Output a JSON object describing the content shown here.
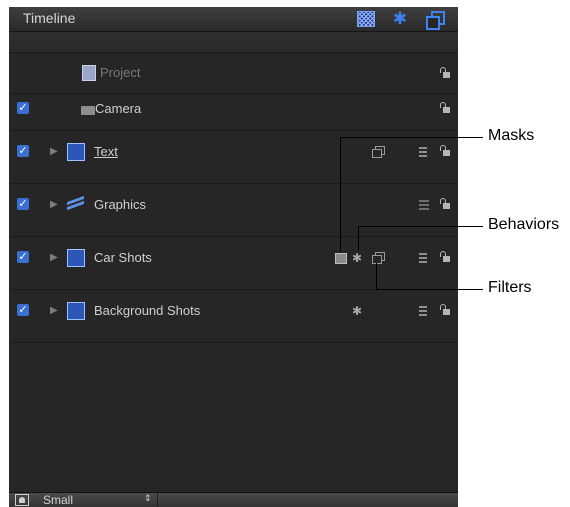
{
  "window": {
    "title": "Timeline"
  },
  "header_buttons": [
    {
      "name": "grid-view-icon"
    },
    {
      "name": "gear-icon"
    },
    {
      "name": "layers-icon"
    }
  ],
  "rows": [
    {
      "label": "Project"
    },
    {
      "label": "Camera"
    },
    {
      "label": "Text"
    },
    {
      "label": "Graphics"
    },
    {
      "label": "Car Shots"
    },
    {
      "label": "Background Shots"
    }
  ],
  "footer": {
    "size_label": "Small",
    "stepper_glyph": "⇕"
  },
  "callouts": {
    "masks": "Masks",
    "behaviors": "Behaviors",
    "filters": "Filters"
  },
  "glyphs": {
    "check": "✓",
    "triangle": "▶",
    "gear": "✱"
  },
  "colors": {
    "panel_bg": "#262626",
    "accent": "#3c7ff0"
  }
}
